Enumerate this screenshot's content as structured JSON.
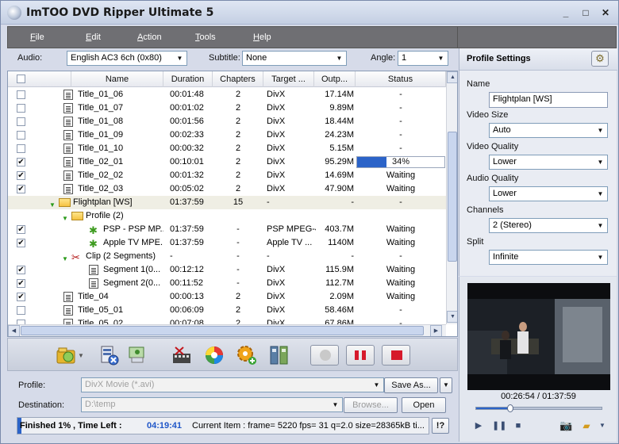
{
  "window": {
    "title": "ImTOO DVD Ripper Ultimate 5"
  },
  "menu": [
    {
      "key": "F",
      "rest": "ile"
    },
    {
      "key": "E",
      "rest": "dit"
    },
    {
      "key": "A",
      "rest": "ction"
    },
    {
      "key": "T",
      "rest": "ools"
    },
    {
      "key": "H",
      "rest": "elp"
    }
  ],
  "options": {
    "audio_label": "Audio:",
    "audio_value": "English AC3 6ch (0x80)",
    "subtitle_label": "Subtitle:",
    "subtitle_value": "None",
    "angle_label": "Angle:",
    "angle_value": "1"
  },
  "columns": [
    "Name",
    "Duration",
    "Chapters",
    "Target ...",
    "Outp...",
    "Status"
  ],
  "rows": [
    {
      "name": "Title_01_06",
      "duration": "00:01:48",
      "chapters": "2",
      "target": "DivX",
      "output": "17.14M",
      "status": "-"
    },
    {
      "name": "Title_01_07",
      "duration": "00:01:02",
      "chapters": "2",
      "target": "DivX",
      "output": "9.89M",
      "status": "-"
    },
    {
      "name": "Title_01_08",
      "duration": "00:01:56",
      "chapters": "2",
      "target": "DivX",
      "output": "18.44M",
      "status": "-"
    },
    {
      "name": "Title_01_09",
      "duration": "00:02:33",
      "chapters": "2",
      "target": "DivX",
      "output": "24.23M",
      "status": "-"
    },
    {
      "name": "Title_01_10",
      "duration": "00:00:32",
      "chapters": "2",
      "target": "DivX",
      "output": "5.15M",
      "status": "-"
    },
    {
      "name": "Title_02_01",
      "duration": "00:10:01",
      "chapters": "2",
      "target": "DivX",
      "output": "95.29M",
      "status": "34%",
      "progress": 0.34
    },
    {
      "name": "Title_02_02",
      "duration": "00:01:32",
      "chapters": "2",
      "target": "DivX",
      "output": "14.69M",
      "status": "Waiting"
    },
    {
      "name": "Title_02_03",
      "duration": "00:05:02",
      "chapters": "2",
      "target": "DivX",
      "output": "47.90M",
      "status": "Waiting"
    },
    {
      "name": "Flightplan [WS]",
      "duration": "01:37:59",
      "chapters": "15",
      "target": "-",
      "output": "-",
      "status": "-"
    },
    {
      "name": "Profile (2)",
      "duration": "",
      "chapters": "",
      "target": "",
      "output": "",
      "status": ""
    },
    {
      "name": "PSP - PSP MP...",
      "duration": "01:37:59",
      "chapters": "-",
      "target": "PSP MPEG-4",
      "output": "403.7M",
      "status": "Waiting"
    },
    {
      "name": "Apple TV MPE...",
      "duration": "01:37:59",
      "chapters": "-",
      "target": "Apple TV ...",
      "output": "1140M",
      "status": "Waiting"
    },
    {
      "name": "Clip (2 Segments)",
      "duration": "-",
      "chapters": "-",
      "target": "-",
      "output": "-",
      "status": "-"
    },
    {
      "name": "Segment 1(0...",
      "duration": "00:12:12",
      "chapters": "-",
      "target": "DivX",
      "output": "115.9M",
      "status": "Waiting"
    },
    {
      "name": "Segment 2(0...",
      "duration": "00:11:52",
      "chapters": "-",
      "target": "DivX",
      "output": "112.7M",
      "status": "Waiting"
    },
    {
      "name": "Title_04",
      "duration": "00:00:13",
      "chapters": "2",
      "target": "DivX",
      "output": "2.09M",
      "status": "Waiting"
    },
    {
      "name": "Title_05_01",
      "duration": "00:06:09",
      "chapters": "2",
      "target": "DivX",
      "output": "58.46M",
      "status": "-"
    },
    {
      "name": "Title_05_02",
      "duration": "00:07:08",
      "chapters": "2",
      "target": "DivX",
      "output": "67.86M",
      "status": "-"
    }
  ],
  "profile_panel": {
    "title": "Profile Settings",
    "name_label": "Name",
    "name_value": "Flightplan [WS]",
    "video_size_label": "Video Size",
    "video_size_value": "Auto",
    "video_quality_label": "Video Quality",
    "video_quality_value": "Lower",
    "audio_quality_label": "Audio Quality",
    "audio_quality_value": "Lower",
    "channels_label": "Channels",
    "channels_value": "2 (Stereo)",
    "split_label": "Split",
    "split_value": "Infinite"
  },
  "preview": {
    "time": "00:26:54 / 01:37:59",
    "position": 0.27
  },
  "bottom": {
    "profile_label": "Profile:",
    "profile_value": "DivX Movie (*.avi)",
    "save_as": "Save As...",
    "destination_label": "Destination:",
    "destination_value": "D:\\temp",
    "browse": "Browse...",
    "open": "Open"
  },
  "status": {
    "finished": "Finished 1%",
    "time_left_label": ", Time Left :",
    "time_left": "04:19:41",
    "current": "Current Item : frame= 5220 fps= 31 q=2.0 size=28365kB ti...",
    "help": "!?",
    "progress": 0.01
  }
}
